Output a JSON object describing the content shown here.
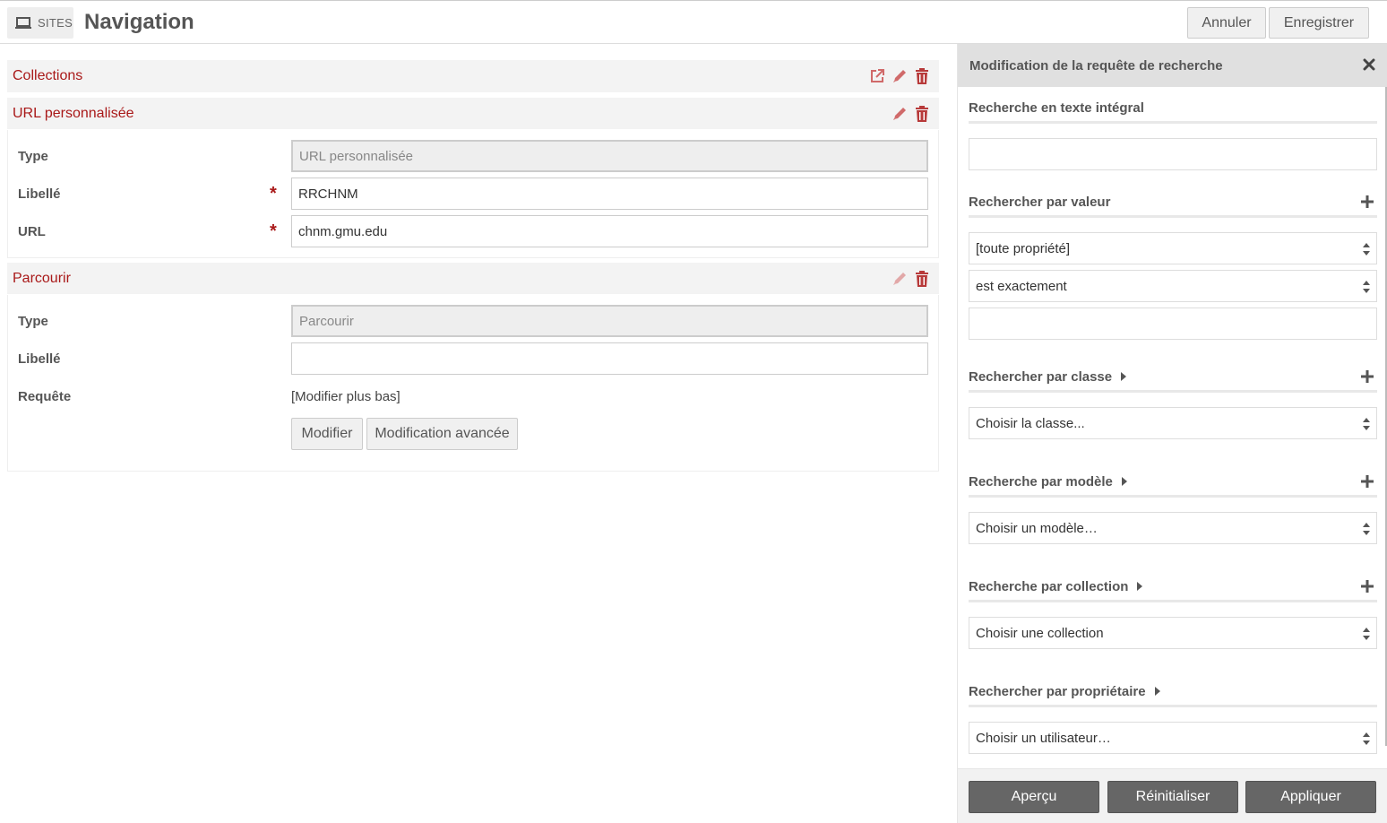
{
  "header": {
    "sites_label": "SITES",
    "title": "Navigation",
    "cancel_label": "Annuler",
    "save_label": "Enregistrer"
  },
  "nav_items": {
    "collections": {
      "label": "Collections"
    },
    "custom_url": {
      "label": "URL personnalisée",
      "type_label": "Type",
      "type_value": "URL personnalisée",
      "label_label": "Libellé",
      "label_value": "RRCHNM",
      "url_label": "URL",
      "url_value": "chnm.gmu.edu"
    },
    "browse": {
      "label": "Parcourir",
      "type_label": "Type",
      "type_value": "Parcourir",
      "label_label": "Libellé",
      "label_value": "",
      "query_label": "Requête",
      "query_value": "[Modifier plus bas]",
      "edit_button": "Modifier",
      "advanced_button": "Modification avancée"
    }
  },
  "sidebar": {
    "title": "Modification de la requête de recherche",
    "fulltext_heading": "Recherche en texte intégral",
    "fulltext_value": "",
    "value_heading": "Rechercher par valeur",
    "property_select": "[toute propriété]",
    "operator_select": "est exactement",
    "value_input": "",
    "class_heading": "Rechercher par classe",
    "class_select": "Choisir la classe...",
    "template_heading": "Recherche par modèle",
    "template_select": "Choisir un modèle…",
    "collection_heading": "Recherche par collection",
    "collection_select": "Choisir une collection",
    "owner_heading": "Rechercher par propriétaire",
    "owner_select": "Choisir un utilisateur…",
    "preview_button": "Aperçu",
    "reset_button": "Réinitialiser",
    "apply_button": "Appliquer"
  },
  "colors": {
    "accent": "#a91919",
    "icon": "#c76b6b",
    "dark_button": "#666666"
  }
}
